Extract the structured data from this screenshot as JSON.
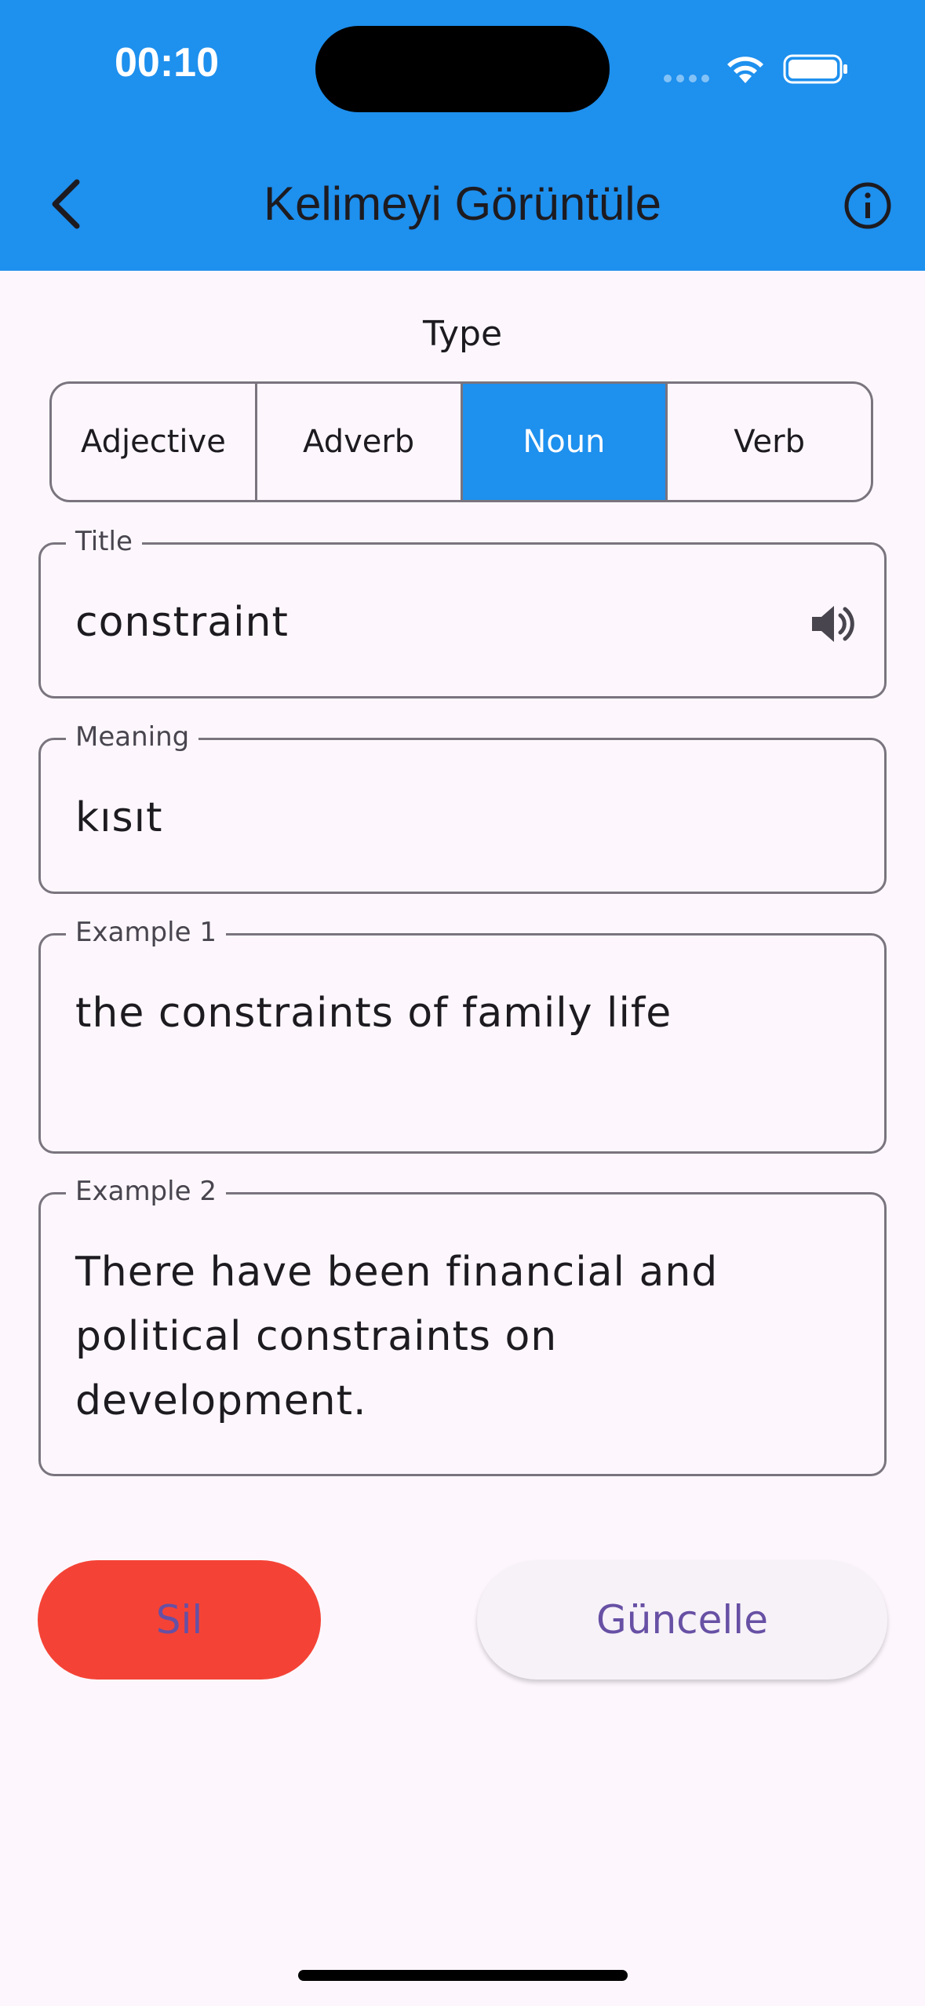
{
  "status_bar": {
    "time": "00:10"
  },
  "app_bar": {
    "title": "Kelimeyi Görüntüle",
    "back_icon": "chevron-left-icon",
    "info_icon": "info-circle-icon"
  },
  "type_selector": {
    "label": "Type",
    "options": [
      "Adjective",
      "Adverb",
      "Noun",
      "Verb"
    ],
    "selected": "Noun"
  },
  "fields": {
    "title": {
      "label": "Title",
      "value": "constraint",
      "icon": "speaker-icon"
    },
    "meaning": {
      "label": "Meaning",
      "value": "kısıt"
    },
    "example1": {
      "label": "Example 1",
      "value": "the constraints of family life"
    },
    "example2": {
      "label": "Example 2",
      "value": "There have been financial and political constraints on development."
    }
  },
  "actions": {
    "delete_label": "Sil",
    "update_label": "Güncelle"
  },
  "colors": {
    "primary": "#1e90ee",
    "danger": "#f44336",
    "button_text": "#6750a4",
    "background": "#fdf7fd"
  }
}
